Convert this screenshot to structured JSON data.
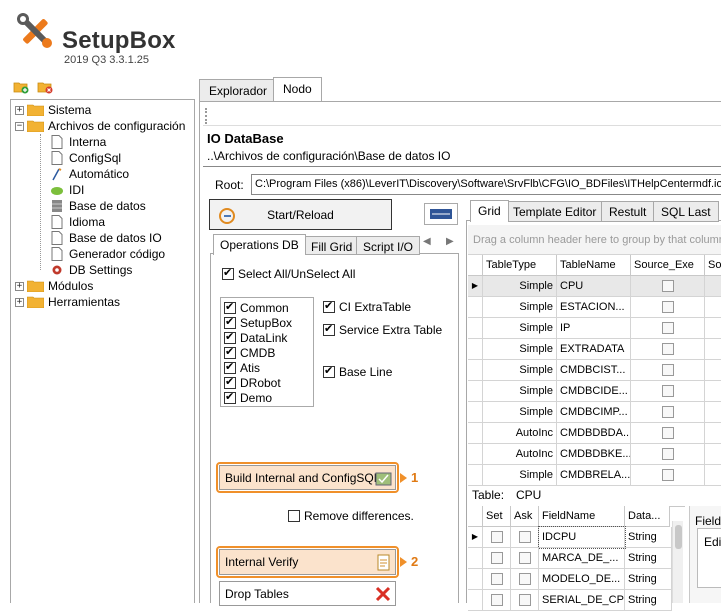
{
  "app": {
    "title": "SetupBox",
    "version": "2019 Q3 3.3.1.25"
  },
  "toolbar": {
    "add_icon": "folder-add-icon",
    "remove_icon": "folder-remove-icon"
  },
  "tree": [
    {
      "label": "Sistema",
      "expander": "+",
      "icon": "folder"
    },
    {
      "label": "Archivos de configuración",
      "expander": "−",
      "icon": "folder"
    },
    {
      "label": "Interna",
      "icon": "doc"
    },
    {
      "label": "ConfigSql",
      "icon": "doc"
    },
    {
      "label": "Automático",
      "icon": "wand"
    },
    {
      "label": "IDI",
      "icon": "cloud"
    },
    {
      "label": "Base de datos",
      "icon": "db"
    },
    {
      "label": "Idioma",
      "icon": "doc"
    },
    {
      "label": "Base de datos IO",
      "icon": "doc"
    },
    {
      "label": "Generador código",
      "icon": "doc"
    },
    {
      "label": "DB Settings",
      "icon": "gear"
    },
    {
      "label": "Módulos",
      "expander": "+",
      "icon": "folder"
    },
    {
      "label": "Herramientas",
      "expander": "+",
      "icon": "folder"
    }
  ],
  "tabs": [
    "Explorador",
    "Nodo"
  ],
  "panel": {
    "title": "IO DataBase",
    "path": "..\\Archivos de configuración\\Base de datos IO",
    "root_label": "Root:",
    "root_value": "C:\\Program Files (x86)\\LeverIT\\Discovery\\Software\\SrvFlb\\CFG\\IO_BDFiles\\ITHelpCentermdf.iod"
  },
  "start_reload": "Start/Reload",
  "left_tabs": [
    "Operations DB",
    "Fill Grid",
    "Script I/O"
  ],
  "select_all": "Select All/UnSelect All",
  "db_list": [
    "Common",
    "SetupBox",
    "DataLink",
    "CMDB",
    "Atis",
    "DRobot",
    "Demo"
  ],
  "options": [
    "CI ExtraTable",
    "Service Extra Table",
    "Base Line"
  ],
  "build_button": "Build Internal and ConfigSQL",
  "callout_1": "1",
  "remove_diff": "Remove differences.",
  "verify_button": "Internal Verify",
  "callout_2": "2",
  "drop_button": "Drop Tables",
  "right_tabs": [
    "Grid",
    "Template Editor",
    "Restult",
    "SQL Last"
  ],
  "group_hint": "Drag a column header here to group by that column",
  "grid_headers": [
    "TableType",
    "TableName",
    "Source_Exe",
    "So"
  ],
  "grid_rows": [
    {
      "type": "Simple",
      "name": "CPU"
    },
    {
      "type": "Simple",
      "name": "ESTACION..."
    },
    {
      "type": "Simple",
      "name": "IP"
    },
    {
      "type": "Simple",
      "name": "EXTRADATA"
    },
    {
      "type": "Simple",
      "name": "CMDBCIST..."
    },
    {
      "type": "Simple",
      "name": "CMDBCIDE..."
    },
    {
      "type": "Simple",
      "name": "CMDBCIMP..."
    },
    {
      "type": "AutoInc",
      "name": "CMDBDBDA..."
    },
    {
      "type": "AutoInc",
      "name": "CMDBDBKE..."
    },
    {
      "type": "Simple",
      "name": "CMDBRELA..."
    }
  ],
  "table_label": "Table:",
  "table_value": "CPU",
  "field_headers": [
    "Set",
    "Ask",
    "FieldName",
    "Data..."
  ],
  "field_rows": [
    {
      "name": "IDCPU",
      "type": "String"
    },
    {
      "name": "MARCA_DE_...",
      "type": "String"
    },
    {
      "name": "MODELO_DE...",
      "type": "String"
    },
    {
      "name": "SERIAL_DE_CPU",
      "type": "String"
    }
  ],
  "field_side": "Field",
  "edit_side": "Edit",
  "colors": {
    "accent": "#f0902a",
    "highlight_bg": "#fbe3cc"
  }
}
